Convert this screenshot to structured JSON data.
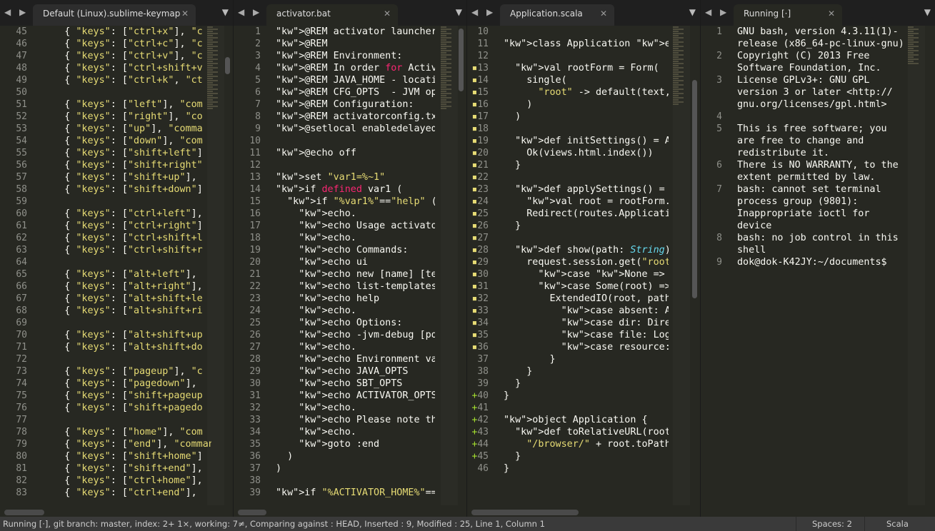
{
  "panes": [
    {
      "tab": "Default (Linux).sublime-keymap",
      "start": 45,
      "lines": [
        "    { \"keys\": [\"ctrl+x\"], \"c",
        "    { \"keys\": [\"ctrl+c\"], \"c",
        "    { \"keys\": [\"ctrl+v\"], \"c",
        "    { \"keys\": [\"ctrl+shift+v",
        "    { \"keys\": [\"ctrl+k\", \"ct",
        "",
        "    { \"keys\": [\"left\"], \"com",
        "    { \"keys\": [\"right\"], \"co",
        "    { \"keys\": [\"up\"], \"comma",
        "    { \"keys\": [\"down\"], \"com",
        "    { \"keys\": [\"shift+left\"]",
        "    { \"keys\": [\"shift+right\"",
        "    { \"keys\": [\"shift+up\"],",
        "    { \"keys\": [\"shift+down\"]",
        "",
        "    { \"keys\": [\"ctrl+left\"],",
        "    { \"keys\": [\"ctrl+right\"]",
        "    { \"keys\": [\"ctrl+shift+l",
        "    { \"keys\": [\"ctrl+shift+r",
        "",
        "    { \"keys\": [\"alt+left\"],",
        "    { \"keys\": [\"alt+right\"],",
        "    { \"keys\": [\"alt+shift+le",
        "    { \"keys\": [\"alt+shift+ri",
        "",
        "    { \"keys\": [\"alt+shift+up",
        "    { \"keys\": [\"alt+shift+do",
        "",
        "    { \"keys\": [\"pageup\"], \"c",
        "    { \"keys\": [\"pagedown\"],",
        "    { \"keys\": [\"shift+pageup",
        "    { \"keys\": [\"shift+pagedo",
        "",
        "    { \"keys\": [\"home\"], \"com",
        "    { \"keys\": [\"end\"], \"command",
        "    { \"keys\": [\"shift+home\"]",
        "    { \"keys\": [\"shift+end\"],",
        "    { \"keys\": [\"ctrl+home\"],",
        "    { \"keys\": [\"ctrl+end\"],"
      ]
    },
    {
      "tab": "activator.bat",
      "start": 1,
      "lines": [
        "@REM activator launcher scri",
        "@REM",
        "@REM Environment:",
        "@REM In order for Activator",
        "@REM JAVA_HOME - location of",
        "@REM CFG_OPTS  - JVM options",
        "@REM Configuration:",
        "@REM activatorconfig.txt fou",
        "@setlocal enabledelayedexpan",
        "",
        "@echo off",
        "",
        "set \"var1=%~1\"",
        "if defined var1 (",
        "  if \"%var1%\"==\"help\" (",
        "    echo.",
        "    echo Usage activator [op",
        "    echo.",
        "    echo Commands:",
        "    echo ui",
        "    echo new [name] [templat",
        "    echo list-templates",
        "    echo help",
        "    echo.",
        "    echo Options:",
        "    echo -jvm-debug [port]",
        "    echo.",
        "    echo Environment variabl",
        "    echo JAVA_OPTS",
        "    echo SBT_OPTS",
        "    echo ACTIVATOR_OPTS",
        "    echo.",
        "    echo Please note that in",
        "    echo.",
        "    goto :end",
        "  )",
        ")",
        "",
        "if \"%ACTIVATOR_HOME%\"==\"\" ("
      ]
    },
    {
      "tab": "Application.scala",
      "start": 10,
      "lines": [
        "",
        "class Application extends Con",
        "",
        "  val rootForm = Form(",
        "    single(",
        "      \"root\" -> default(text,",
        "    )",
        "  )",
        "",
        "  def initSettings() = Action",
        "    Ok(views.html.index())",
        "  }",
        "",
        "  def applySettings() = Actio",
        "    val root = rootForm.bindF",
        "    Redirect(routes.Applicati",
        "  }",
        "",
        "  def show(path: String) = Ac",
        "    request.session.get(\"root",
        "      case None => Redirect(r",
        "      case Some(root) =>",
        "        ExtendedIO(root, path",
        "          case absent: Absent",
        "          case dir: Directory",
        "          case file: Log => O",
        "          case resource: Reso",
        "        }",
        "    }",
        "  }",
        "}",
        "",
        "object Application {",
        "  def toRelativeURL(root: Fil",
        "    \"/browser/\" + root.toPath",
        "  }",
        "}"
      ],
      "markers": [
        "",
        "",
        "",
        "m",
        "m",
        "m",
        "m",
        "m",
        "m",
        "m",
        "m",
        "m",
        "m",
        "m",
        "m",
        "m",
        "m",
        "m",
        "m",
        "m",
        "m",
        "m",
        "m",
        "m",
        "m",
        "m",
        "m",
        "",
        "",
        "",
        "a",
        "a",
        "a",
        "a",
        "a",
        "a",
        ""
      ]
    },
    {
      "tab": "Running [·]",
      "terminal": [
        {
          "n": "1",
          "rows": [
            "GNU bash, version 4.3.11(1)-",
            "release (x86_64-pc-linux-gnu)"
          ]
        },
        {
          "n": "2",
          "rows": [
            "Copyright (C) 2013 Free",
            "Software Foundation, Inc."
          ]
        },
        {
          "n": "3",
          "rows": [
            "License GPLv3+: GNU GPL",
            "version 3 or later <http://",
            "gnu.org/licenses/gpl.html>"
          ]
        },
        {
          "n": "4",
          "rows": [
            ""
          ]
        },
        {
          "n": "5",
          "rows": [
            "This is free software; you",
            "are free to change and",
            "redistribute it."
          ]
        },
        {
          "n": "6",
          "rows": [
            "There is NO WARRANTY, to the",
            "extent permitted by law."
          ]
        },
        {
          "n": "7",
          "rows": [
            "bash: cannot set terminal",
            "process group (9801):",
            "Inappropriate ioctl for",
            "device"
          ]
        },
        {
          "n": "8",
          "rows": [
            "bash: no job control in this",
            "shell"
          ]
        },
        {
          "n": "9",
          "rows": [
            "dok@dok-K42JY:~/documents$"
          ]
        }
      ]
    }
  ],
  "status": {
    "text": "Running [·], git branch: master, index: 2+ 1×, working: 7≠, Comparing against : HEAD, Inserted : 9, Modified : 25, Line 1, Column 1",
    "spaces": "Spaces: 2",
    "syntax": "Scala"
  },
  "colors": {
    "background": "#272822",
    "keyword": "#f92672",
    "string": "#e6db74",
    "function": "#a6e22e",
    "type": "#66d9ef",
    "param": "#fd971f"
  }
}
